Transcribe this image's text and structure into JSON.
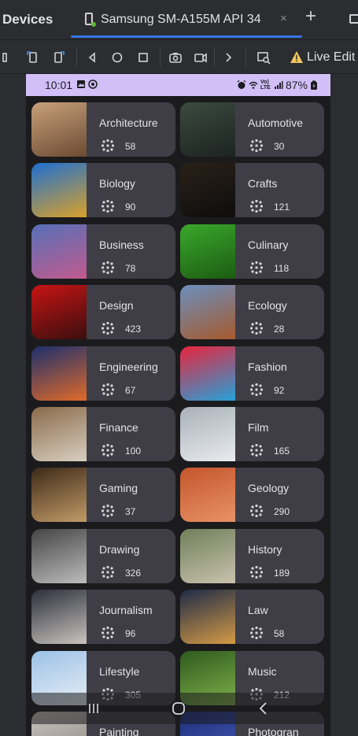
{
  "ide": {
    "toolwindow_title": "Devices",
    "tab_label": "Samsung SM-A155M API 34",
    "tab_close": "×",
    "tab_add": "+",
    "live_edit_label": "Live Edit"
  },
  "status_bar": {
    "time": "10:01",
    "network": "Vo) LTE",
    "battery": "87%"
  },
  "categories": [
    {
      "name": "Architecture",
      "count": "58"
    },
    {
      "name": "Automotive",
      "count": "30"
    },
    {
      "name": "Biology",
      "count": "90"
    },
    {
      "name": "Crafts",
      "count": "121"
    },
    {
      "name": "Business",
      "count": "78"
    },
    {
      "name": "Culinary",
      "count": "118"
    },
    {
      "name": "Design",
      "count": "423"
    },
    {
      "name": "Ecology",
      "count": "28"
    },
    {
      "name": "Engineering",
      "count": "67"
    },
    {
      "name": "Fashion",
      "count": "92"
    },
    {
      "name": "Finance",
      "count": "100"
    },
    {
      "name": "Film",
      "count": "165"
    },
    {
      "name": "Gaming",
      "count": "37"
    },
    {
      "name": "Geology",
      "count": "290"
    },
    {
      "name": "Drawing",
      "count": "326"
    },
    {
      "name": "History",
      "count": "189"
    },
    {
      "name": "Journalism",
      "count": "96"
    },
    {
      "name": "Law",
      "count": "58"
    },
    {
      "name": "Lifestyle",
      "count": "305"
    },
    {
      "name": "Music",
      "count": "212"
    },
    {
      "name": "Painting",
      "count": ""
    },
    {
      "name": "Photogran",
      "count": ""
    }
  ],
  "thumb_colors": [
    [
      "#c8a17a",
      "#6b4b33"
    ],
    [
      "#3b4a3e",
      "#1c2422"
    ],
    [
      "#1e6fd0",
      "#d9a12a"
    ],
    [
      "#2a2118",
      "#0d0d0d"
    ],
    [
      "#5570b8",
      "#c25a8e"
    ],
    [
      "#3aa82c",
      "#1c5c12"
    ],
    [
      "#c81414",
      "#3a0e0e"
    ],
    [
      "#6b8fbf",
      "#a65a2c"
    ],
    [
      "#1c2f6e",
      "#e06a2a"
    ],
    [
      "#e8243c",
      "#26a1d9"
    ],
    [
      "#8a6a4a",
      "#d8cfc0"
    ],
    [
      "#a8b0b8",
      "#e9ecef"
    ],
    [
      "#3d2a18",
      "#c29a68"
    ],
    [
      "#c4552c",
      "#e89266"
    ],
    [
      "#444444",
      "#bcbcbc"
    ],
    [
      "#6f7f5a",
      "#c9c2ad"
    ],
    [
      "#2b2f3a",
      "#c8c3bd"
    ],
    [
      "#1e2a48",
      "#d49a45"
    ],
    [
      "#9bc1e6",
      "#e8eef6"
    ],
    [
      "#2d5a1e",
      "#7fb04a"
    ],
    [
      "#c9c4bf",
      "#8a857f"
    ],
    [
      "#1c2c7a",
      "#4b5fb8"
    ]
  ]
}
